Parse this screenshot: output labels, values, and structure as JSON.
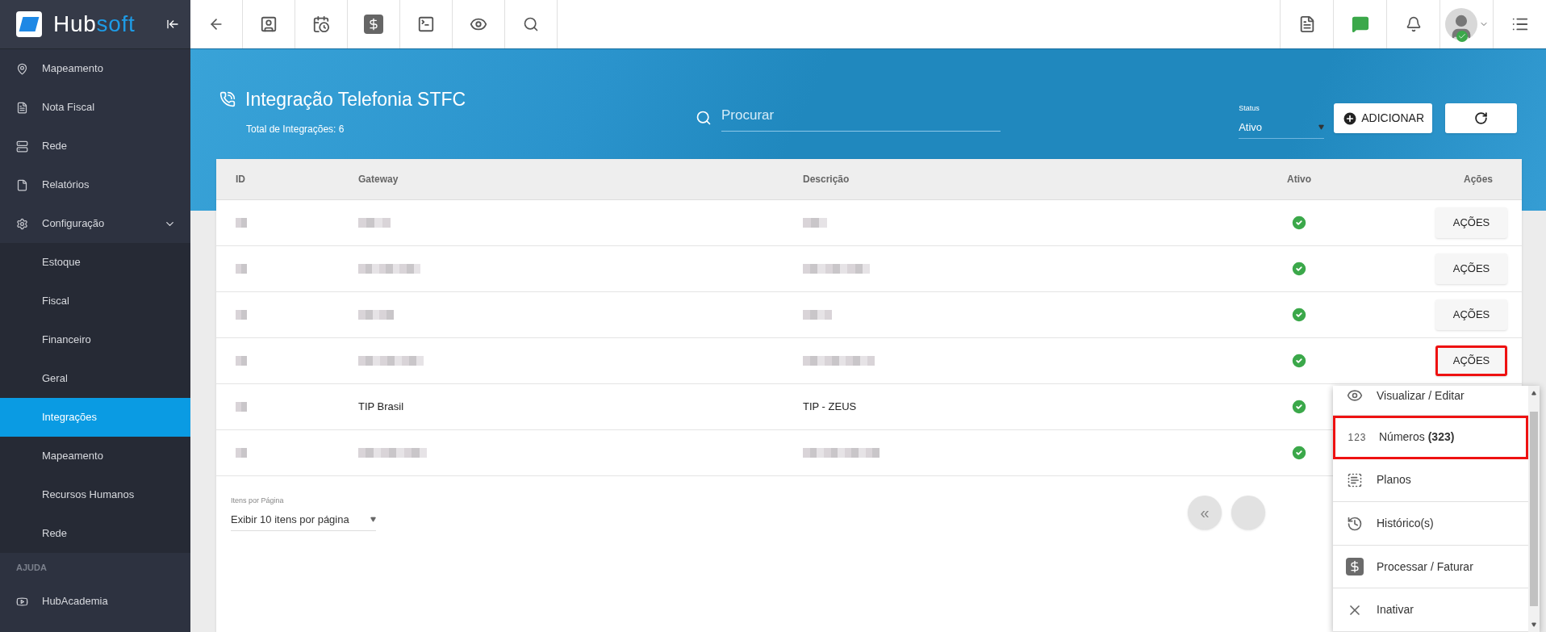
{
  "brand": {
    "name_a": "Hub",
    "name_b": "soft"
  },
  "sidebar": {
    "items": [
      {
        "label": "Mapeamento",
        "selected": false
      },
      {
        "label": "Nota Fiscal",
        "selected": false
      },
      {
        "label": "Rede",
        "selected": false
      },
      {
        "label": "Relatórios",
        "selected": false
      },
      {
        "label": "Configuração",
        "selected": false,
        "expanded": true,
        "children": [
          {
            "label": "Estoque",
            "selected": false
          },
          {
            "label": "Fiscal",
            "selected": false
          },
          {
            "label": "Financeiro",
            "selected": false
          },
          {
            "label": "Geral",
            "selected": false
          },
          {
            "label": "Integrações",
            "selected": true
          },
          {
            "label": "Mapeamento",
            "selected": false
          },
          {
            "label": "Recursos Humanos",
            "selected": false
          },
          {
            "label": "Rede",
            "selected": false
          }
        ]
      }
    ],
    "section": "AJUDA",
    "help_items": [
      {
        "label": "HubAcademia",
        "selected": false
      }
    ]
  },
  "page": {
    "title": "Integração Telefonia STFC",
    "subtitle": "Total de Integrações: 6",
    "search": {
      "placeholder": "Procurar"
    },
    "status": {
      "label": "Status",
      "value": "Ativo"
    },
    "add_button": "ADICIONAR"
  },
  "table": {
    "columns": [
      "ID",
      "Gateway",
      "Descrição",
      "Ativo",
      "Ações"
    ],
    "rows": [
      {
        "id": {
          "blurred": true
        },
        "gateway": {
          "blurred": true
        },
        "description": {
          "blurred": true
        },
        "active": true,
        "action": "AÇÕES",
        "highlighted": false
      },
      {
        "id": {
          "blurred": true
        },
        "gateway": {
          "blurred": true
        },
        "description": {
          "blurred": true
        },
        "active": true,
        "action": "AÇÕES",
        "highlighted": false
      },
      {
        "id": {
          "blurred": true
        },
        "gateway": {
          "blurred": true
        },
        "description": {
          "blurred": true
        },
        "active": true,
        "action": "AÇÕES",
        "highlighted": false
      },
      {
        "id": {
          "blurred": true
        },
        "gateway": {
          "blurred": true
        },
        "description": {
          "blurred": true
        },
        "active": true,
        "action": "AÇÕES",
        "highlighted": true
      },
      {
        "id": {
          "blurred": true
        },
        "gateway": {
          "blurred": false,
          "text": "TIP Brasil"
        },
        "description": {
          "blurred": false,
          "text": "TIP - ZEUS"
        },
        "active": true
      },
      {
        "id": {
          "blurred": true
        },
        "gateway": {
          "blurred": true
        },
        "description": {
          "blurred": true
        },
        "active": true
      }
    ]
  },
  "pagination": {
    "label": "Itens por Página",
    "value": "Exibir 10 itens por página",
    "first_button": "«"
  },
  "menu": {
    "items": [
      {
        "kind": "view",
        "label": "Visualizar / Editar",
        "selected": false
      },
      {
        "kind": "numbers",
        "glyph": "123",
        "label": "Números **(323)**",
        "selected": true
      },
      {
        "kind": "plans",
        "label": "Planos",
        "selected": false
      },
      {
        "kind": "history",
        "label": "Histórico(s)",
        "selected": false
      },
      {
        "kind": "billing",
        "label": "Processar / Faturar",
        "selected": false
      },
      {
        "kind": "deactivate",
        "label": "Inativar",
        "selected": false
      }
    ]
  }
}
